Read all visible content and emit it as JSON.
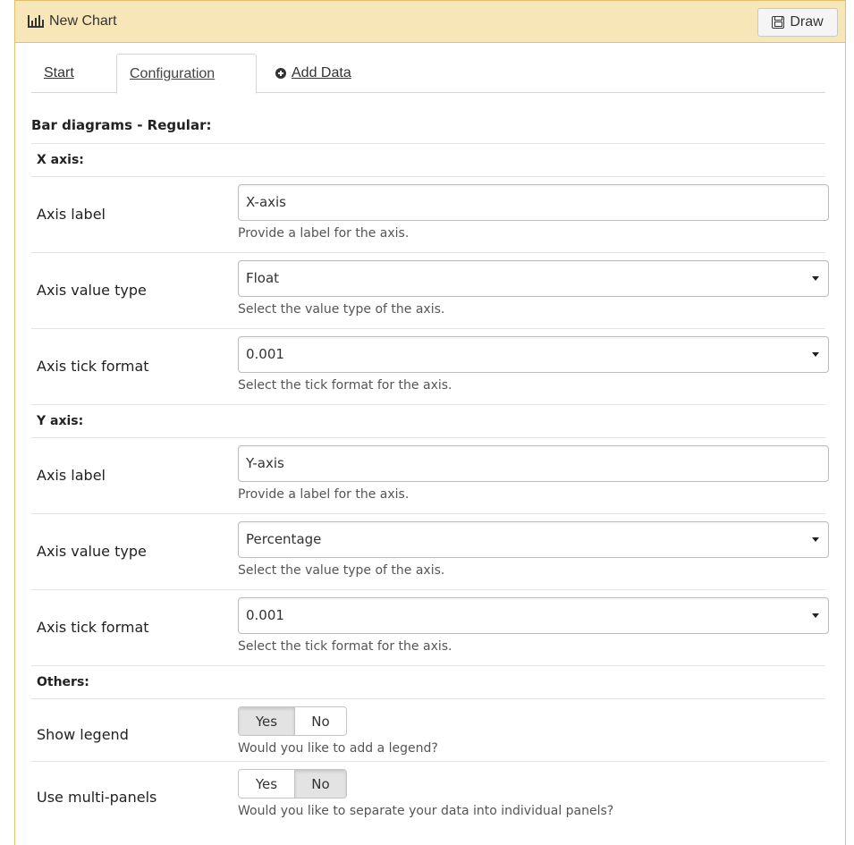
{
  "header": {
    "title": "New Chart",
    "draw_label": "Draw"
  },
  "tabs": [
    {
      "label": "Start",
      "active": false
    },
    {
      "label": "Configuration",
      "active": true
    },
    {
      "label": "Add Data",
      "active": false
    }
  ],
  "form": {
    "title": "Bar diagrams - Regular:",
    "x_axis": {
      "heading": "X axis:",
      "label_row": {
        "label": "Axis label",
        "value": "X-axis",
        "help": "Provide a label for the axis."
      },
      "type_row": {
        "label": "Axis value type",
        "value": "Float",
        "help": "Select the value type of the axis."
      },
      "tick_row": {
        "label": "Axis tick format",
        "value": "0.001",
        "help": "Select the tick format for the axis."
      }
    },
    "y_axis": {
      "heading": "Y axis:",
      "label_row": {
        "label": "Axis label",
        "value": "Y-axis",
        "help": "Provide a label for the axis."
      },
      "type_row": {
        "label": "Axis value type",
        "value": "Percentage",
        "help": "Select the value type of the axis."
      },
      "tick_row": {
        "label": "Axis tick format",
        "value": "0.001",
        "help": "Select the tick format for the axis."
      }
    },
    "others": {
      "heading": "Others:",
      "legend": {
        "label": "Show legend",
        "yes": "Yes",
        "no": "No",
        "selected": "Yes",
        "help": "Would you like to add a legend?"
      },
      "multipanel": {
        "label": "Use multi-panels",
        "yes": "Yes",
        "no": "No",
        "selected": "No",
        "help": "Would you like to separate your data into individual panels?"
      }
    }
  },
  "icons": {
    "title_icon": "bar-chart-icon",
    "draw_icon": "save-icon",
    "add_data_icon": "plus-circle-icon",
    "select_icon": "caret-down-icon"
  },
  "colors": {
    "header_bg": "#f7e6b8",
    "header_border": "#e2c06b",
    "toggle_selected": "#e3e3e3"
  }
}
